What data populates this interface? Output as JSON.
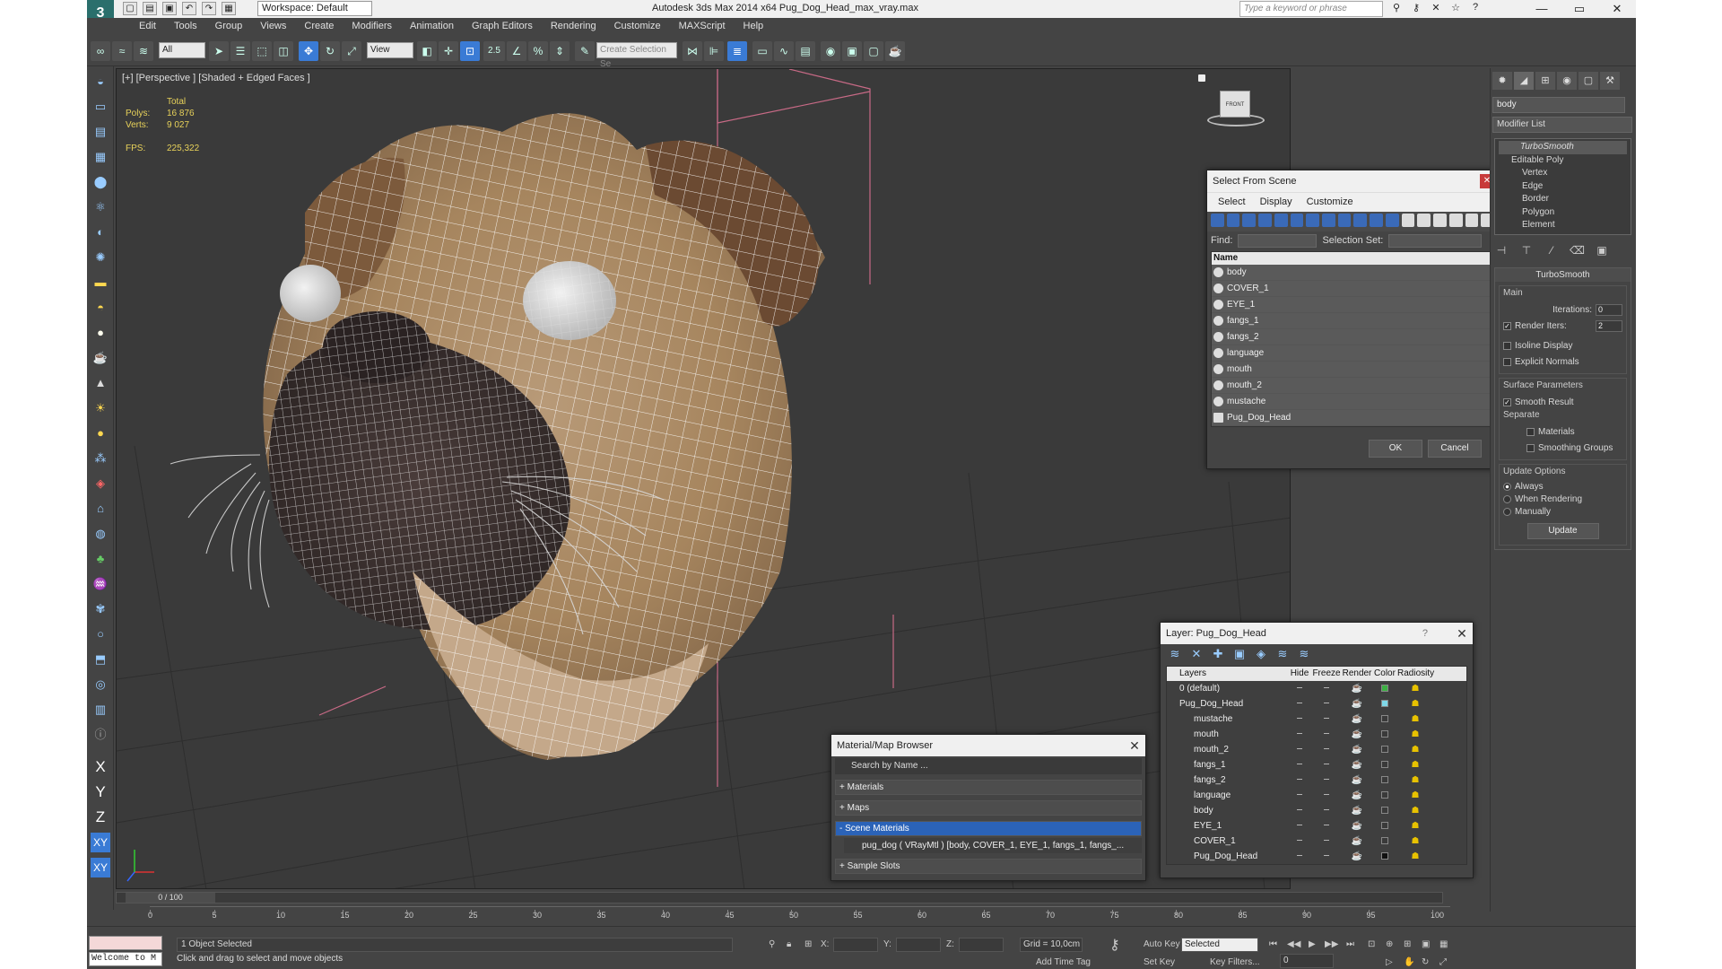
{
  "titlebar": {
    "workspace": "Workspace: Default",
    "title": "Autodesk 3ds Max  2014 x64     Pug_Dog_Head_max_vray.max",
    "search_placeholder": "Type a keyword or phrase",
    "minimize": "—",
    "maximize": "▭",
    "close": "✕"
  },
  "menu": [
    "Edit",
    "Tools",
    "Group",
    "Views",
    "Create",
    "Modifiers",
    "Animation",
    "Graph Editors",
    "Rendering",
    "Customize",
    "MAXScript",
    "Help"
  ],
  "toolbar": {
    "selection_filter": "All",
    "ref_coord": "View",
    "snap_angle": "2.5",
    "named_selection": "Create Selection Se"
  },
  "left_axes": [
    "X",
    "Y",
    "Z",
    "XY",
    "XY"
  ],
  "viewport": {
    "label": "[+] [Perspective ] [Shaded + Edged Faces ]",
    "stats_header": "Total",
    "polys_label": "Polys:",
    "polys": "16 876",
    "verts_label": "Verts:",
    "verts": "9 027",
    "fps_label": "FPS:",
    "fps": "225,322",
    "viewcube": "FRONT"
  },
  "select_from_scene": {
    "title": "Select From Scene",
    "menu": [
      "Select",
      "Display",
      "Customize"
    ],
    "find_label": "Find:",
    "selection_set_label": "Selection Set:",
    "column_name": "Name",
    "objects": [
      "body",
      "COVER_1",
      "EYE_1",
      "fangs_1",
      "fangs_2",
      "language",
      "mouth",
      "mouth_2",
      "mustache",
      "Pug_Dog_Head"
    ],
    "ok": "OK",
    "cancel": "Cancel"
  },
  "layer_dialog": {
    "title": "Layer: Pug_Dog_Head",
    "help": "?",
    "columns": [
      "Layers",
      "Hide",
      "Freeze",
      "Render",
      "Color",
      "Radiosity"
    ],
    "rows": [
      {
        "name": "0 (default)",
        "color": "#3cb043"
      },
      {
        "name": "Pug_Dog_Head",
        "color": "#7fd8e8"
      },
      {
        "name": "mustache",
        "color": "#3a3a3a"
      },
      {
        "name": "mouth",
        "color": "#3a3a3a"
      },
      {
        "name": "mouth_2",
        "color": "#3a3a3a"
      },
      {
        "name": "fangs_1",
        "color": "#3a3a3a"
      },
      {
        "name": "fangs_2",
        "color": "#3a3a3a"
      },
      {
        "name": "language",
        "color": "#3a3a3a"
      },
      {
        "name": "body",
        "color": "#3a3a3a"
      },
      {
        "name": "EYE_1",
        "color": "#3a3a3a"
      },
      {
        "name": "COVER_1",
        "color": "#3a3a3a"
      },
      {
        "name": "Pug_Dog_Head",
        "color": "#111111"
      }
    ]
  },
  "material_browser": {
    "title": "Material/Map Browser",
    "search_placeholder": "Search by Name ...",
    "sections": [
      "+ Materials",
      "+ Maps",
      "- Scene Materials"
    ],
    "scene_material": "pug_dog  ( VRayMtl )  [body, COVER_1, EYE_1, fangs_1, fangs_...",
    "sample_slots": "+ Sample Slots"
  },
  "command_panel": {
    "object_name": "body",
    "modifier_list": "Modifier List",
    "stack": {
      "turbosmooth": "TurboSmooth",
      "editable_poly": "Editable Poly",
      "subobjects": [
        "Vertex",
        "Edge",
        "Border",
        "Polygon",
        "Element"
      ]
    },
    "rollout_title": "TurboSmooth",
    "main_label": "Main",
    "iterations_label": "Iterations:",
    "iterations": "0",
    "render_iters_label": "Render Iters:",
    "render_iters": "2",
    "isoline": "Isoline Display",
    "explicit_normals": "Explicit Normals",
    "surface_params": "Surface Parameters",
    "smooth_result": "Smooth Result",
    "separate": "Separate",
    "materials": "Materials",
    "smoothing_groups": "Smoothing Groups",
    "update_options": "Update Options",
    "always": "Always",
    "when_rendering": "When Rendering",
    "manually": "Manually",
    "update_button": "Update"
  },
  "timeline": {
    "frame_display": "0 / 100",
    "ticks": [
      "0",
      "5",
      "10",
      "15",
      "20",
      "25",
      "30",
      "35",
      "40",
      "45",
      "50",
      "55",
      "60",
      "65",
      "70",
      "75",
      "80",
      "85",
      "90",
      "95",
      "100"
    ]
  },
  "status": {
    "maxscript_text": "Welcome to M",
    "selection": "1 Object Selected",
    "prompt": "Click and drag to select and move objects",
    "x_label": "X:",
    "y_label": "Y:",
    "z_label": "Z:",
    "grid": "Grid = 10,0cm",
    "add_time_tag": "Add Time Tag",
    "auto_key": "Auto Key",
    "auto_key_mode": "Selected",
    "set_key": "Set Key",
    "key_filters": "Key Filters...",
    "current_frame": "0"
  }
}
